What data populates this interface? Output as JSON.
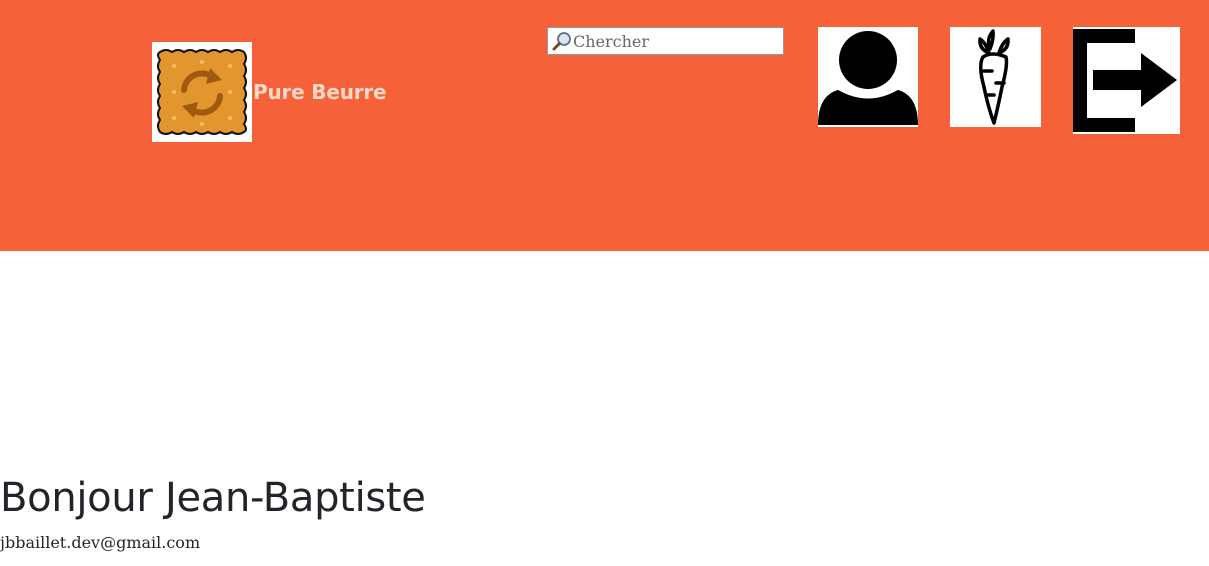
{
  "colors": {
    "header_bg": "#f5623a",
    "brand_text": "#f8d8c8",
    "text": "#212529",
    "logo_cookie": "#e3962e",
    "logo_arrows": "#a05a10"
  },
  "header": {
    "brand": {
      "logo_icon": "cookie-refresh-logo",
      "name": "Pure Beurre"
    },
    "search": {
      "icon": "magnifier-icon",
      "placeholder": "Chercher",
      "value": ""
    },
    "nav": [
      {
        "icon": "user-icon"
      },
      {
        "icon": "carrot-icon"
      },
      {
        "icon": "logout-icon"
      }
    ]
  },
  "main": {
    "greeting": "Bonjour Jean-Baptiste",
    "email": "jbbaillet.dev@gmail.com"
  }
}
